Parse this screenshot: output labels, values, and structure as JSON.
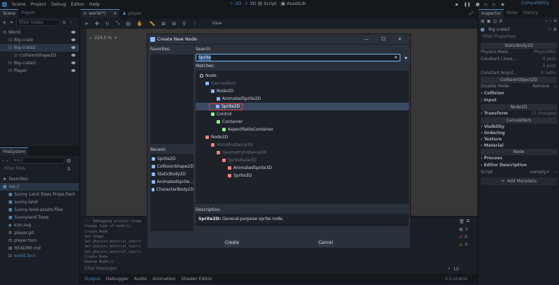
{
  "menu": [
    "Scene",
    "Project",
    "Debug",
    "Editor",
    "Help"
  ],
  "workspaces": [
    "2D",
    "3D",
    "Script",
    "AssetLib"
  ],
  "renderer": "Compatibility",
  "scene_panel": {
    "tabs": [
      "Scene",
      "Import"
    ],
    "filter_placeholder": "Filter nodes",
    "nodes": [
      {
        "label": "World",
        "depth": 0,
        "color": "#e0e0e0"
      },
      {
        "label": "Big-crate",
        "depth": 1,
        "color": "#8fb8ff"
      },
      {
        "label": "Big-crate2",
        "depth": 1,
        "color": "#8fb8ff"
      },
      {
        "label": "CollisionShape2D",
        "depth": 2,
        "color": "#8fb8ff"
      },
      {
        "label": "Big-crate3",
        "depth": 1,
        "color": "#8fb8ff"
      },
      {
        "label": "Player",
        "depth": 1,
        "color": "#8fb8ff"
      }
    ]
  },
  "filesystem": {
    "tab": "FileSystem",
    "path": "res://",
    "filter_placeholder": "Filter Files",
    "items": [
      {
        "label": "Favorites:",
        "depth": 0,
        "icon": "star-icon"
      },
      {
        "label": "res://",
        "depth": 0,
        "icon": "folder-icon"
      },
      {
        "label": "Sunny Land Trees Props Pack",
        "depth": 1,
        "icon": "folder-icon"
      },
      {
        "label": "sunny-land",
        "depth": 1,
        "icon": "folder-icon"
      },
      {
        "label": "Sunny-land-assets-files",
        "depth": 1,
        "icon": "folder-icon"
      },
      {
        "label": "Sunnyland Trees",
        "depth": 1,
        "icon": "folder-icon"
      },
      {
        "label": "icon.svg",
        "depth": 1,
        "icon": "image-icon"
      },
      {
        "label": "player.gd",
        "depth": 1,
        "icon": "script-icon"
      },
      {
        "label": "player.tscn",
        "depth": 1,
        "icon": "scene-icon"
      },
      {
        "label": "README.md",
        "depth": 1,
        "icon": "doc-icon"
      },
      {
        "label": "world.tscn",
        "depth": 1,
        "icon": "scene-icon"
      }
    ]
  },
  "editor_tabs": [
    "world(*)",
    "player"
  ],
  "viewport": {
    "zoom": "224.5 %",
    "view_label": "View"
  },
  "output": {
    "lines": [
      "--- Debugging process stopp",
      "Change type of node(s)",
      "Create Node",
      "Set shape",
      "Set physics_material_overri",
      "Set physics_material_overri",
      "Set physics_material_overri",
      "Create Node",
      "Remove Node(s)"
    ],
    "filter_placeholder": "Filter Messages",
    "bottom_tabs": [
      "Output",
      "Debugger",
      "Audio",
      "Animation",
      "Shader Editor"
    ],
    "counts": [
      "3",
      "0",
      "0",
      "10"
    ],
    "version": "4.0.stable"
  },
  "dialog": {
    "title": "Create New Node",
    "favorites_label": "Favorites:",
    "recent_label": "Recent:",
    "recent": [
      "Sprite2D",
      "CollisionShape2D",
      "StaticBody2D",
      "AnimatedSprite...",
      "CharacterBody2D"
    ],
    "search_label": "Search:",
    "search_value": "Sprite",
    "matches_label": "Matches:",
    "matches": [
      {
        "label": "Node",
        "depth": 0,
        "dim": false,
        "selected": false
      },
      {
        "label": "CanvasItem",
        "depth": 1,
        "dim": true,
        "selected": false
      },
      {
        "label": "Node2D",
        "depth": 2,
        "dim": false,
        "selected": false
      },
      {
        "label": "AnimatedSprite2D",
        "depth": 3,
        "dim": false,
        "selected": false
      },
      {
        "label": "Sprite2D",
        "depth": 3,
        "dim": false,
        "selected": true
      },
      {
        "label": "Control",
        "depth": 2,
        "dim": false,
        "selected": false
      },
      {
        "label": "Container",
        "depth": 3,
        "dim": false,
        "selected": false
      },
      {
        "label": "AspectRatioContainer",
        "depth": 4,
        "dim": false,
        "selected": false
      },
      {
        "label": "Node3D",
        "depth": 1,
        "dim": false,
        "selected": false
      },
      {
        "label": "VisualInstance3D",
        "depth": 2,
        "dim": true,
        "selected": false
      },
      {
        "label": "GeometryInstance3D",
        "depth": 3,
        "dim": true,
        "selected": false
      },
      {
        "label": "SpriteBase3D",
        "depth": 4,
        "dim": true,
        "selected": false
      },
      {
        "label": "AnimatedSprite3D",
        "depth": 5,
        "dim": false,
        "selected": false
      },
      {
        "label": "Sprite3D",
        "depth": 5,
        "dim": false,
        "selected": false
      }
    ],
    "description_label": "Description:",
    "description_name": "Sprite2D:",
    "description_text": " General-purpose sprite node.",
    "create": "Create",
    "cancel": "Cancel"
  },
  "inspector": {
    "tabs": [
      "Inspector",
      "Node",
      "History"
    ],
    "node_name": "Big-crate2",
    "filter_placeholder": "Filter Properties",
    "class_static": "StaticBody2D",
    "props_static": [
      {
        "label": "Physics Mate...",
        "value": "PhysicsMa"
      },
      {
        "label": "Constant Linea...",
        "value": "0  px/s"
      },
      {
        "label": "",
        "value": "0  px/s"
      },
      {
        "label": "Constant Angul...",
        "value": "0  rad/s"
      }
    ],
    "class_collision": "CollisionObject2D",
    "disable_mode_label": "Disable Mode",
    "disable_mode_value": "Remove",
    "collision": "Collision",
    "input": "Input",
    "class_node2d": "Node2D",
    "transform": "Transform",
    "transform_changes": "(2 changes)",
    "class_canvas": "CanvasItem",
    "canvas_sections": [
      "Visibility",
      "Ordering",
      "Texture",
      "Material"
    ],
    "class_node": "Node",
    "process": "Process",
    "editor_description": "Editor Description",
    "script_label": "Script",
    "script_value": "<empty>",
    "add_metadata": "Add Metadata"
  }
}
